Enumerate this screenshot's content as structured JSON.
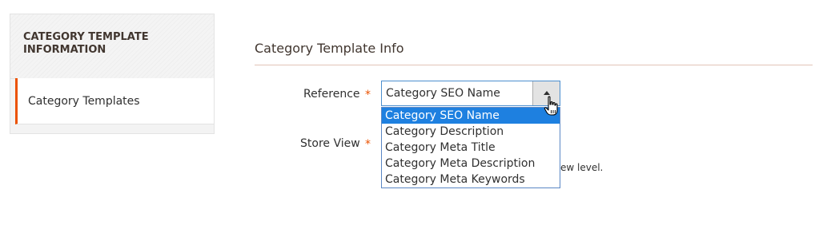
{
  "sidebar": {
    "title": "CATEGORY TEMPLATE INFORMATION",
    "items": [
      {
        "label": "Category Templates"
      }
    ]
  },
  "main": {
    "section_title": "Category Template Info",
    "fields": {
      "reference": {
        "label": "Reference",
        "required_mark": "*",
        "value": "Category SEO Name",
        "options": [
          "Category SEO Name",
          "Category Description",
          "Category Meta Title",
          "Category Meta Description",
          "Category Meta Keywords"
        ],
        "selected_index": 0
      },
      "store_view": {
        "label": "Store View",
        "required_mark": "*",
        "hint_partial": "ew level."
      }
    }
  },
  "colors": {
    "accent": "#eb5202",
    "select_focus": "#1e80e0"
  }
}
